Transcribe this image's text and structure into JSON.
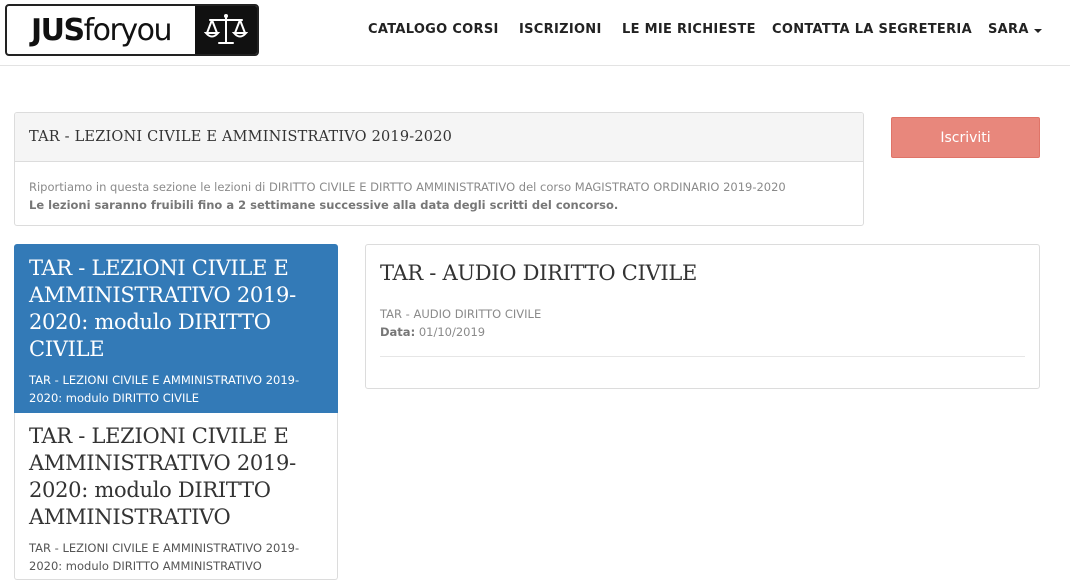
{
  "logo": {
    "part1": "JUS",
    "part2": "foryou",
    "mark_icon": "scales-of-justice-icon"
  },
  "nav": {
    "catalogo": "CATALOGO CORSI",
    "iscrizioni": "ISCRIZIONI",
    "richieste": "LE MIE RICHIESTE",
    "segreteria": "CONTATTA LA SEGRETERIA",
    "user": "SARA"
  },
  "course": {
    "title": "TAR - LEZIONI CIVILE E AMMINISTRATIVO 2019-2020",
    "description": "Riportiamo in questa sezione le lezioni di DIRITTO CIVILE E DIRTTO AMMINISTRATIVO del corso MAGISTRATO ORDINARIO 2019-2020",
    "notice": "Le lezioni saranno fruibili fino a 2 settimane successive alla data degli scritti del concorso.",
    "enroll_label": "Iscriviti"
  },
  "modules": [
    {
      "title": "TAR - LEZIONI CIVILE E AMMINISTRATIVO 2019-2020: modulo DIRITTO CIVILE",
      "subtitle": "TAR - LEZIONI CIVILE E AMMINISTRATIVO 2019-2020: modulo DIRITTO CIVILE"
    },
    {
      "title": "TAR - LEZIONI CIVILE E AMMINISTRATIVO 2019-2020: modulo DIRITTO AMMINISTRATIVO",
      "subtitle": "TAR - LEZIONI CIVILE E AMMINISTRATIVO 2019-2020: modulo DIRITTO AMMINISTRATIVO"
    }
  ],
  "lesson": {
    "title": "TAR - AUDIO DIRITTO CIVILE",
    "subtitle": "TAR - AUDIO DIRITTO CIVILE",
    "date_label": "Data:",
    "date_value": "01/10/2019"
  },
  "colors": {
    "active_module": "#337ab7",
    "enroll_button": "#e8877c"
  }
}
